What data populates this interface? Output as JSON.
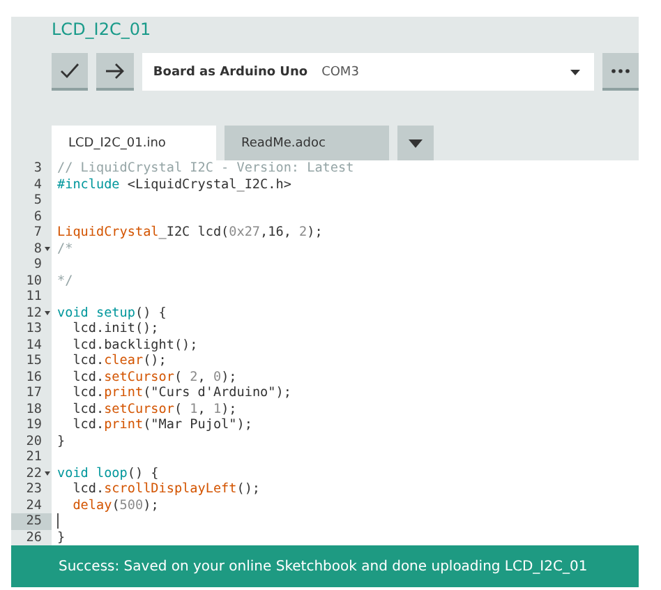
{
  "sketch": {
    "title": "LCD_I2C_01"
  },
  "toolbar": {
    "board": "Board as Arduino Uno",
    "port": "COM3"
  },
  "tabs": [
    {
      "label": "LCD_I2C_01.ino",
      "selected": true
    },
    {
      "label": "ReadMe.adoc",
      "selected": false
    }
  ],
  "code": [
    {
      "number": "3",
      "foldable": false,
      "current": false,
      "indented": false,
      "tokens": [
        {
          "kind": "comment",
          "text": "// LiquidCrystal I2C - Version: Latest"
        }
      ]
    },
    {
      "number": "4",
      "foldable": false,
      "current": false,
      "indented": false,
      "tokens": [
        {
          "kind": "keyword",
          "text": "#include"
        },
        {
          "kind": "plain",
          "text": " <LiquidCrystal_I2C.h>"
        }
      ]
    },
    {
      "number": "5",
      "foldable": false,
      "current": false
    },
    {
      "number": "6",
      "foldable": false,
      "current": false
    },
    {
      "number": "7",
      "foldable": false,
      "current": false,
      "indented": false,
      "tokens": [
        {
          "kind": "function",
          "text": "LiquidCrystal"
        },
        {
          "kind": "plain",
          "text": "_I2C lcd("
        },
        {
          "kind": "number",
          "text": "0x27"
        },
        {
          "kind": "plain",
          "text": ",16, "
        },
        {
          "kind": "number",
          "text": "2"
        },
        {
          "kind": "plain",
          "text": ");"
        }
      ]
    },
    {
      "number": "8",
      "foldable": true,
      "current": false,
      "indented": false,
      "tokens": [
        {
          "kind": "comment",
          "text": "/*"
        }
      ]
    },
    {
      "number": "9",
      "foldable": false,
      "current": false
    },
    {
      "number": "10",
      "foldable": false,
      "current": false,
      "indented": false,
      "tokens": [
        {
          "kind": "comment",
          "text": "*/"
        }
      ]
    },
    {
      "number": "11",
      "foldable": false,
      "current": false
    },
    {
      "number": "12",
      "foldable": true,
      "current": false,
      "indented": false,
      "tokens": [
        {
          "kind": "keyword",
          "text": "void"
        },
        {
          "kind": "keyword",
          "text": " setup"
        },
        {
          "kind": "plain",
          "text": "() {"
        }
      ]
    },
    {
      "number": "13",
      "foldable": false,
      "current": false,
      "indented": true,
      "tokens": [
        {
          "kind": "plain",
          "text": "lcd.init();"
        }
      ]
    },
    {
      "number": "14",
      "foldable": false,
      "current": false,
      "indented": true,
      "tokens": [
        {
          "kind": "plain",
          "text": "lcd.backlight();"
        }
      ]
    },
    {
      "number": "15",
      "foldable": false,
      "current": false,
      "indented": true,
      "tokens": [
        {
          "kind": "plain",
          "text": "lcd."
        },
        {
          "kind": "function",
          "text": "clear"
        },
        {
          "kind": "plain",
          "text": "();"
        }
      ]
    },
    {
      "number": "16",
      "foldable": false,
      "current": false,
      "indented": true,
      "tokens": [
        {
          "kind": "plain",
          "text": "lcd."
        },
        {
          "kind": "function",
          "text": "setCursor"
        },
        {
          "kind": "plain",
          "text": "( "
        },
        {
          "kind": "number",
          "text": "2"
        },
        {
          "kind": "plain",
          "text": ", "
        },
        {
          "kind": "number",
          "text": "0"
        },
        {
          "kind": "plain",
          "text": ");"
        }
      ]
    },
    {
      "number": "17",
      "foldable": false,
      "current": false,
      "indented": true,
      "tokens": [
        {
          "kind": "plain",
          "text": "lcd."
        },
        {
          "kind": "function",
          "text": "print"
        },
        {
          "kind": "plain",
          "text": "(\"Curs d'Arduino\");"
        }
      ]
    },
    {
      "number": "18",
      "foldable": false,
      "current": false,
      "indented": true,
      "tokens": [
        {
          "kind": "plain",
          "text": "lcd."
        },
        {
          "kind": "function",
          "text": "setCursor"
        },
        {
          "kind": "plain",
          "text": "( "
        },
        {
          "kind": "number",
          "text": "1"
        },
        {
          "kind": "plain",
          "text": ", "
        },
        {
          "kind": "number",
          "text": "1"
        },
        {
          "kind": "plain",
          "text": ");"
        }
      ]
    },
    {
      "number": "19",
      "foldable": false,
      "current": false,
      "indented": true,
      "tokens": [
        {
          "kind": "plain",
          "text": "lcd."
        },
        {
          "kind": "function",
          "text": "print"
        },
        {
          "kind": "plain",
          "text": "(\"Mar Pujol\");"
        }
      ]
    },
    {
      "number": "20",
      "foldable": false,
      "current": false,
      "indented": false,
      "tokens": [
        {
          "kind": "plain",
          "text": "}"
        }
      ]
    },
    {
      "number": "21",
      "foldable": false,
      "current": false
    },
    {
      "number": "22",
      "foldable": true,
      "current": false,
      "indented": false,
      "tokens": [
        {
          "kind": "keyword",
          "text": "void"
        },
        {
          "kind": "keyword",
          "text": " loop"
        },
        {
          "kind": "plain",
          "text": "() {"
        }
      ]
    },
    {
      "number": "23",
      "foldable": false,
      "current": false,
      "indented": true,
      "tokens": [
        {
          "kind": "plain",
          "text": "lcd."
        },
        {
          "kind": "function",
          "text": "scrollDisplayLeft"
        },
        {
          "kind": "plain",
          "text": "();"
        }
      ]
    },
    {
      "number": "24",
      "foldable": false,
      "current": false,
      "indented": true,
      "tokens": [
        {
          "kind": "function",
          "text": "delay"
        },
        {
          "kind": "plain",
          "text": "("
        },
        {
          "kind": "number",
          "text": "500"
        },
        {
          "kind": "plain",
          "text": ");"
        }
      ]
    },
    {
      "number": "25",
      "foldable": false,
      "current": true
    },
    {
      "number": "26",
      "foldable": false,
      "current": false,
      "indented": false,
      "tokens": [
        {
          "kind": "plain",
          "text": "}"
        }
      ]
    }
  ],
  "status": {
    "message": "Success: Saved on your online Sketchbook and done uploading LCD_I2C_01"
  }
}
